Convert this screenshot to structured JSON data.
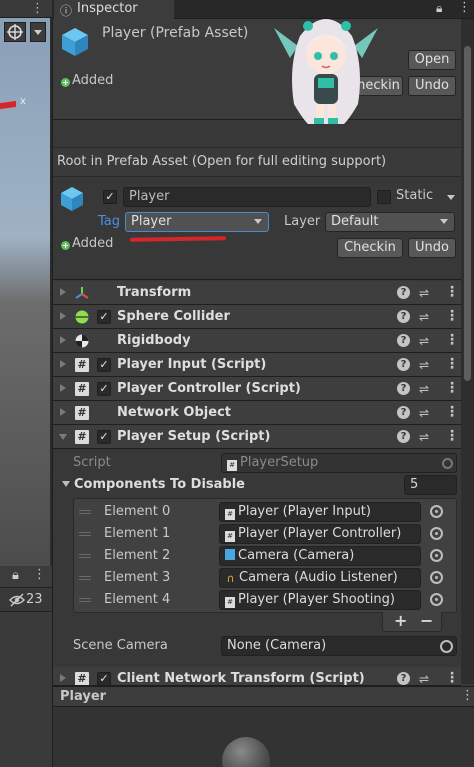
{
  "inspector": {
    "tab_label": "Inspector",
    "asset_title": "Player (Prefab Asset)",
    "open_button": "Open",
    "added_label": "Added",
    "checkin_button_top": "Checkin",
    "undo_button_top": "Undo",
    "root_note": "Root in Prefab Asset (Open for full editing support)"
  },
  "gameobject": {
    "name": "Player",
    "static_label": "Static",
    "tag_label": "Tag",
    "tag_value": "Player",
    "layer_label": "Layer",
    "layer_value": "Default",
    "added_label": "Added",
    "checkin_button": "Checkin",
    "undo_button": "Undo"
  },
  "components": [
    {
      "name": "Transform",
      "icon": "transform-icon",
      "has_checkbox": false,
      "expanded": false
    },
    {
      "name": "Sphere Collider",
      "icon": "sphere-collider-icon",
      "has_checkbox": true,
      "expanded": false
    },
    {
      "name": "Rigidbody",
      "icon": "rigidbody-icon",
      "has_checkbox": false,
      "expanded": false
    },
    {
      "name": "Player Input (Script)",
      "icon": "script-icon",
      "has_checkbox": true,
      "expanded": false
    },
    {
      "name": "Player Controller (Script)",
      "icon": "script-icon",
      "has_checkbox": true,
      "expanded": false
    },
    {
      "name": "Network Object",
      "icon": "script-icon",
      "has_checkbox": false,
      "expanded": false
    },
    {
      "name": "Player Setup (Script)",
      "icon": "script-icon",
      "has_checkbox": true,
      "expanded": true
    },
    {
      "name": "Client Network Transform (Script)",
      "icon": "script-icon",
      "has_checkbox": true,
      "expanded": false
    }
  ],
  "player_setup": {
    "script_label": "Script",
    "script_value": "PlayerSetup",
    "components_to_disable_label": "Components To Disable",
    "array_size": "5",
    "elements": [
      {
        "label": "Element 0",
        "value": "Player (Player Input)",
        "icon": "script-icon"
      },
      {
        "label": "Element 1",
        "value": "Player (Player Controller)",
        "icon": "script-icon"
      },
      {
        "label": "Element 2",
        "value": "Camera (Camera)",
        "icon": "camera-icon"
      },
      {
        "label": "Element 3",
        "value": "Camera (Audio Listener)",
        "icon": "headphones-icon"
      },
      {
        "label": "Element 4",
        "value": "Player (Player Shooting)",
        "icon": "script-icon"
      }
    ],
    "add_button": "+",
    "remove_button": "−",
    "scene_camera_label": "Scene Camera",
    "scene_camera_value": "None (Camera)"
  },
  "preview": {
    "title": "Player"
  },
  "scene_panel": {
    "visibility_count": "23",
    "axis_label": "x"
  },
  "colors": {
    "accent_tag_label": "#4a90e2",
    "annotation_underline": "#d6262a",
    "added_badge": "#5cc05c"
  }
}
